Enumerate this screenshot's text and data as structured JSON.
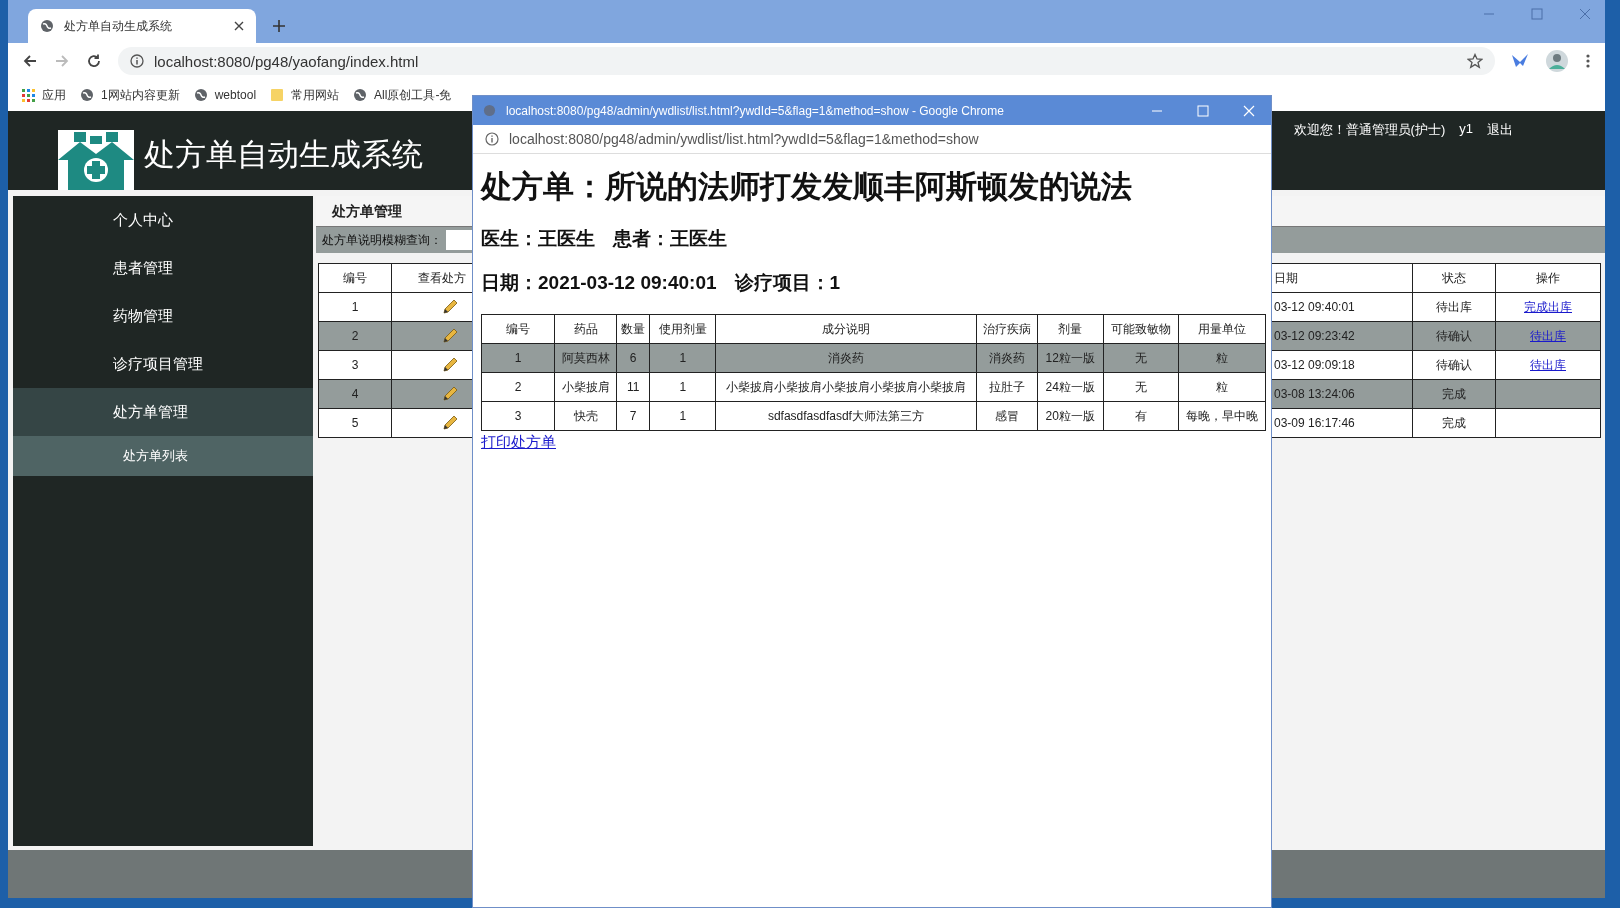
{
  "browser": {
    "tabs": [
      {
        "title": "处方单自动生成系统",
        "selected": true
      }
    ],
    "url": "localhost:8080/pg48/yaofang/index.html",
    "bookmarks": [
      {
        "label": "应用",
        "kind": "apps"
      },
      {
        "label": "1网站内容更新",
        "kind": "globe"
      },
      {
        "label": "webtool",
        "kind": "globe"
      },
      {
        "label": "常用网站",
        "kind": "folder"
      },
      {
        "label": "All原创工具-免",
        "kind": "globe"
      }
    ]
  },
  "header": {
    "title": "处方单自动生成系统",
    "welcome": "欢迎您！普通管理员(护士)",
    "account": "y1",
    "logout": "退出"
  },
  "sidebar": {
    "items": [
      {
        "label": "个人中心",
        "selected": false
      },
      {
        "label": "患者管理",
        "selected": false
      },
      {
        "label": "药物管理",
        "selected": false
      },
      {
        "label": "诊疗项目管理",
        "selected": false
      },
      {
        "label": "处方单管理",
        "selected": true,
        "expanded": true,
        "children": [
          {
            "label": "处方单列表",
            "selected": true
          }
        ]
      }
    ]
  },
  "main": {
    "title": "处方单管理",
    "search_label": "处方单说明模糊查询：",
    "table": {
      "left_columns": [
        "编号",
        "查看处方"
      ],
      "right_columns": [
        "日期",
        "状态",
        "操作"
      ],
      "rows": [
        {
          "id": "1",
          "date": "03-12 09:40:01",
          "status": "待出库",
          "action": "完成出库"
        },
        {
          "id": "2",
          "date": "03-12 09:23:42",
          "status": "待确认",
          "action": "待出库"
        },
        {
          "id": "3",
          "date": "03-12 09:09:18",
          "status": "待确认",
          "action": "待出库"
        },
        {
          "id": "4",
          "date": "03-08 13:24:06",
          "status": "完成"
        },
        {
          "id": "5",
          "date": "03-09 16:17:46",
          "status": "完成"
        }
      ]
    }
  },
  "popup": {
    "title": "localhost:8080/pg48/admin/ywdlist/list.html?ywdId=5&flag=1&method=show - Google Chrome",
    "url": "localhost:8080/pg48/admin/ywdlist/list.html?ywdId=5&flag=1&method=show",
    "heading": "处方单：所说的法师打发发顺丰阿斯顿发的说法",
    "doctor": "医生：王医生",
    "patient": "患者：王医生",
    "date": "日期：2021-03-12 09:40:01",
    "project": "诊疗项目：1",
    "table": {
      "columns": [
        "编号",
        "药品",
        "数量",
        "使用剂量",
        "成分说明",
        "治疗疾病",
        "剂量",
        "可能致敏物",
        "用量单位"
      ],
      "rows": [
        [
          "1",
          "阿莫西林",
          "6",
          "1",
          "消炎药",
          "消炎药",
          "12粒一版",
          "无",
          "粒"
        ],
        [
          "2",
          "小柴披肩",
          "11",
          "1",
          "小柴披肩小柴披肩小柴披肩小柴披肩小柴披肩",
          "拉肚子",
          "24粒一版",
          "无",
          "粒"
        ],
        [
          "3",
          "快壳",
          "7",
          "1",
          "sdfasdfasdfasdf大师法第三方",
          "感冒",
          "20粒一版",
          "有",
          "每晚，早中晚"
        ]
      ]
    },
    "print_link": "打印处方单"
  }
}
